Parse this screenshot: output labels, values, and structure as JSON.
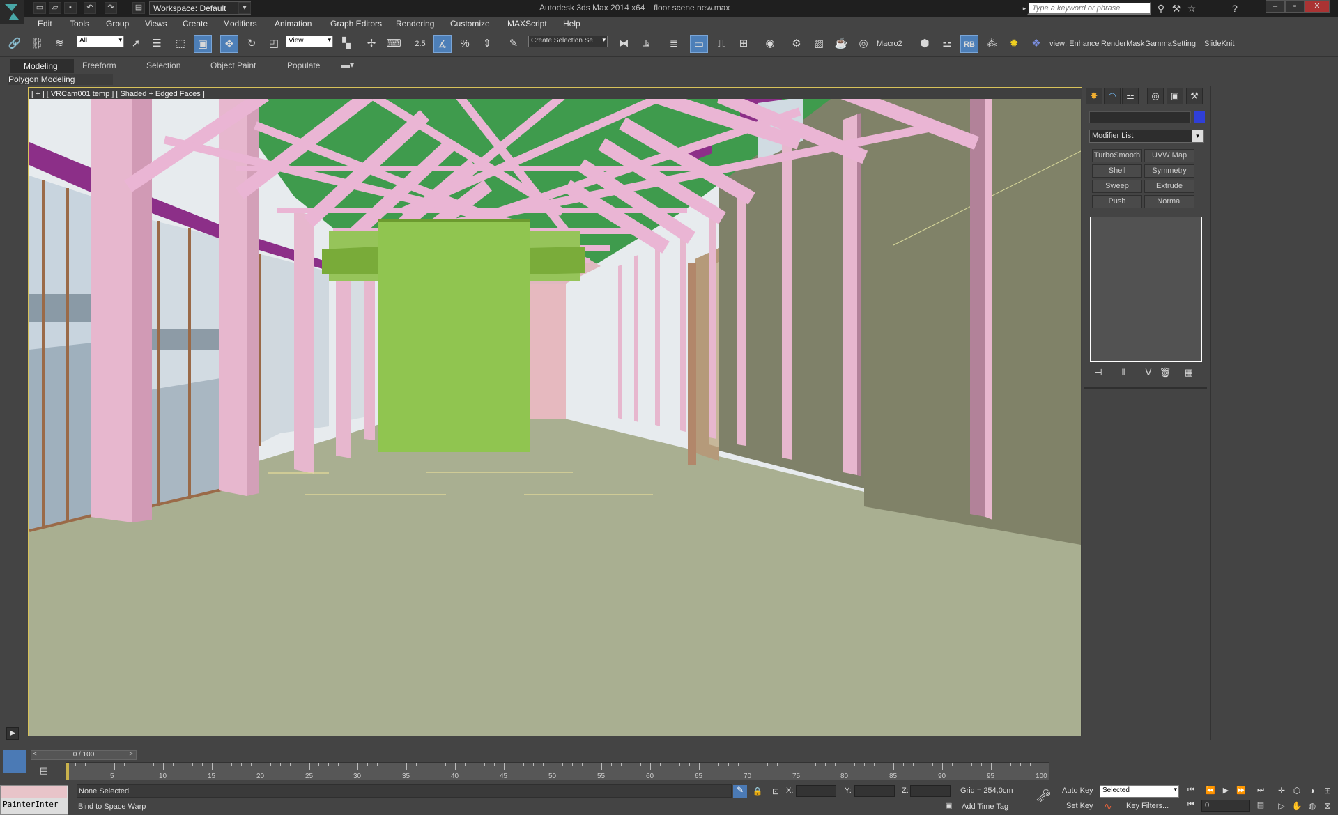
{
  "title": {
    "app": "Autodesk 3ds Max  2014 x64",
    "file": "floor scene new.max",
    "workspace": "Workspace: Default",
    "search_placeholder": "Type a keyword or phrase"
  },
  "menu": [
    "Edit",
    "Tools",
    "Group",
    "Views",
    "Create",
    "Modifiers",
    "Animation",
    "Graph Editors",
    "Rendering",
    "Customize",
    "MAXScript",
    "Help"
  ],
  "toolbar": {
    "filter": "All",
    "refcoord": "View",
    "snap_value": "2.5",
    "selection_set": "Create Selection Se",
    "macro": "Macro2",
    "rb": "RB",
    "scripts": [
      "view: Enhance",
      "RenderMask",
      "GammaSetting:",
      "SlideKnit"
    ]
  },
  "ribbon": {
    "tabs": [
      "Modeling",
      "Freeform",
      "Selection",
      "Object Paint",
      "Populate"
    ],
    "panel": "Polygon Modeling"
  },
  "viewport": {
    "label": "[ + ] [ VRCam001 temp ] [ Shaded + Edged Faces ]"
  },
  "command_panel": {
    "modifier_list": "Modifier List",
    "buttons": [
      "TurboSmooth",
      "UVW Map",
      "Shell",
      "Symmetry",
      "Sweep",
      "Extrude",
      "Push",
      "Normal"
    ],
    "object_color": "#2f3fd8"
  },
  "timeline": {
    "slider": "0 / 100",
    "ticks": [
      "5",
      "10",
      "15",
      "20",
      "25",
      "30",
      "35",
      "40",
      "45",
      "50",
      "55",
      "60",
      "65",
      "70",
      "75",
      "80",
      "85",
      "90",
      "95",
      "100"
    ]
  },
  "status": {
    "selection": "None Selected",
    "prompt": "Bind to Space Warp",
    "x": "X:",
    "y": "Y:",
    "z": "Z:",
    "grid": "Grid = 254,0cm",
    "add_time_tag": "Add Time Tag",
    "auto_key": "Auto Key",
    "set_key": "Set Key",
    "key_mode": "Selected",
    "key_filters": "Key Filters...",
    "frame": "0",
    "painter": "PainterInter"
  },
  "colors": {
    "accent": "#4d7fb8",
    "viewport_border": "#d8c25a",
    "floor": "#a8ae90",
    "beams": "#e6b8cf",
    "roof": "#3f9a4d",
    "wall": "#7e8068",
    "box": "#8cc44f"
  }
}
